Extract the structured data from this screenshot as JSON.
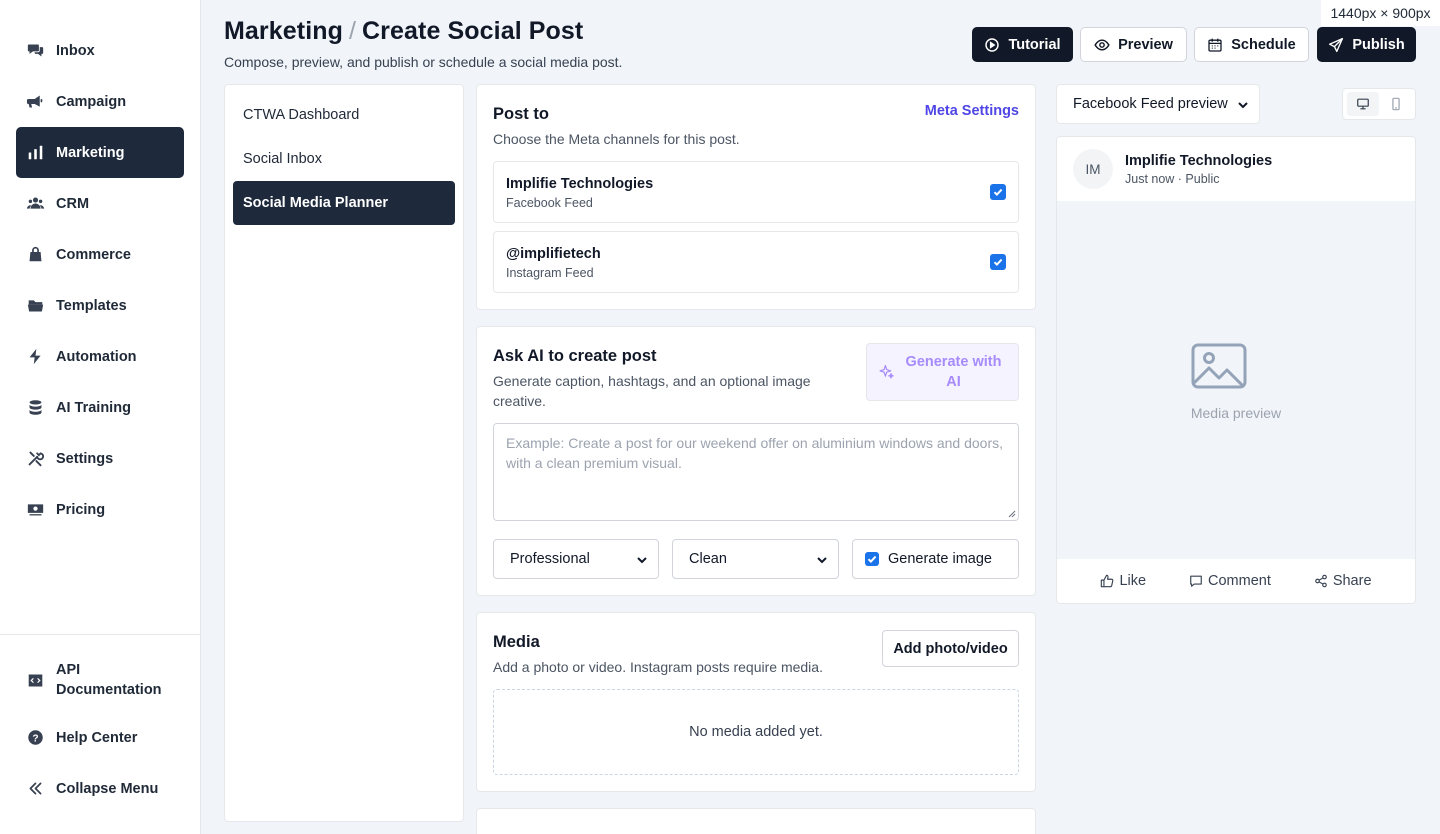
{
  "sidebar": {
    "items": [
      {
        "label": "Inbox",
        "icon": "chat-bubbles-icon"
      },
      {
        "label": "Campaign",
        "icon": "megaphone-icon"
      },
      {
        "label": "Marketing",
        "icon": "bar-chart-icon",
        "active": true
      },
      {
        "label": "CRM",
        "icon": "users-icon"
      },
      {
        "label": "Commerce",
        "icon": "shopping-bag-icon"
      },
      {
        "label": "Templates",
        "icon": "folder-icon"
      },
      {
        "label": "Automation",
        "icon": "lightning-icon"
      },
      {
        "label": "AI Training",
        "icon": "database-icon"
      },
      {
        "label": "Settings",
        "icon": "tools-icon"
      },
      {
        "label": "Pricing",
        "icon": "money-icon"
      }
    ],
    "bottom": [
      {
        "label": "API Documentation",
        "icon": "code-icon"
      },
      {
        "label": "Help Center",
        "icon": "question-icon"
      },
      {
        "label": "Collapse Menu",
        "icon": "double-chevron-left-icon"
      }
    ]
  },
  "header": {
    "breadcrumb_parent": "Marketing",
    "breadcrumb_sep": "/",
    "title": "Create Social Post",
    "subtitle": "Compose, preview, and publish or schedule a social media post.",
    "dimension_badge": "1440px × 900px",
    "buttons": {
      "tutorial": "Tutorial",
      "preview": "Preview",
      "schedule": "Schedule",
      "publish": "Publish"
    }
  },
  "subnav": {
    "items": [
      "CTWA Dashboard",
      "Social Inbox",
      "Social Media Planner"
    ],
    "active_index": 2
  },
  "post_to": {
    "title": "Post to",
    "subtitle": "Choose the Meta channels for this post.",
    "settings_link": "Meta Settings",
    "channels": [
      {
        "name": "Implifie Technologies",
        "type": "Facebook Feed",
        "checked": true
      },
      {
        "name": "@implifietech",
        "type": "Instagram Feed",
        "checked": true
      }
    ]
  },
  "ai": {
    "title": "Ask AI to create post",
    "subtitle": "Generate caption, hashtags, and an optional image creative.",
    "generate_label": "Generate with AI",
    "prompt_placeholder": "Example: Create a post for our weekend offer on aluminium windows and doors, with a clean premium visual.",
    "tone_value": "Professional",
    "style_value": "Clean",
    "generate_image_label": "Generate image",
    "generate_image_checked": true
  },
  "media": {
    "title": "Media",
    "subtitle": "Add a photo or video. Instagram posts require media.",
    "add_label": "Add photo/video",
    "empty_text": "No media added yet."
  },
  "preview": {
    "mode_value": "Facebook Feed preview",
    "avatar_initials": "IM",
    "page_name": "Implifie Technologies",
    "meta": "Just now · Public",
    "media_placeholder": "Media preview",
    "actions": {
      "like": "Like",
      "comment": "Comment",
      "share": "Share"
    }
  },
  "colors": {
    "sidebar_active": "#1e293b",
    "primary_dark": "#111827",
    "link": "#4f46e5",
    "ai_accent": "#a78bfa",
    "checkbox": "#1a73e8"
  }
}
